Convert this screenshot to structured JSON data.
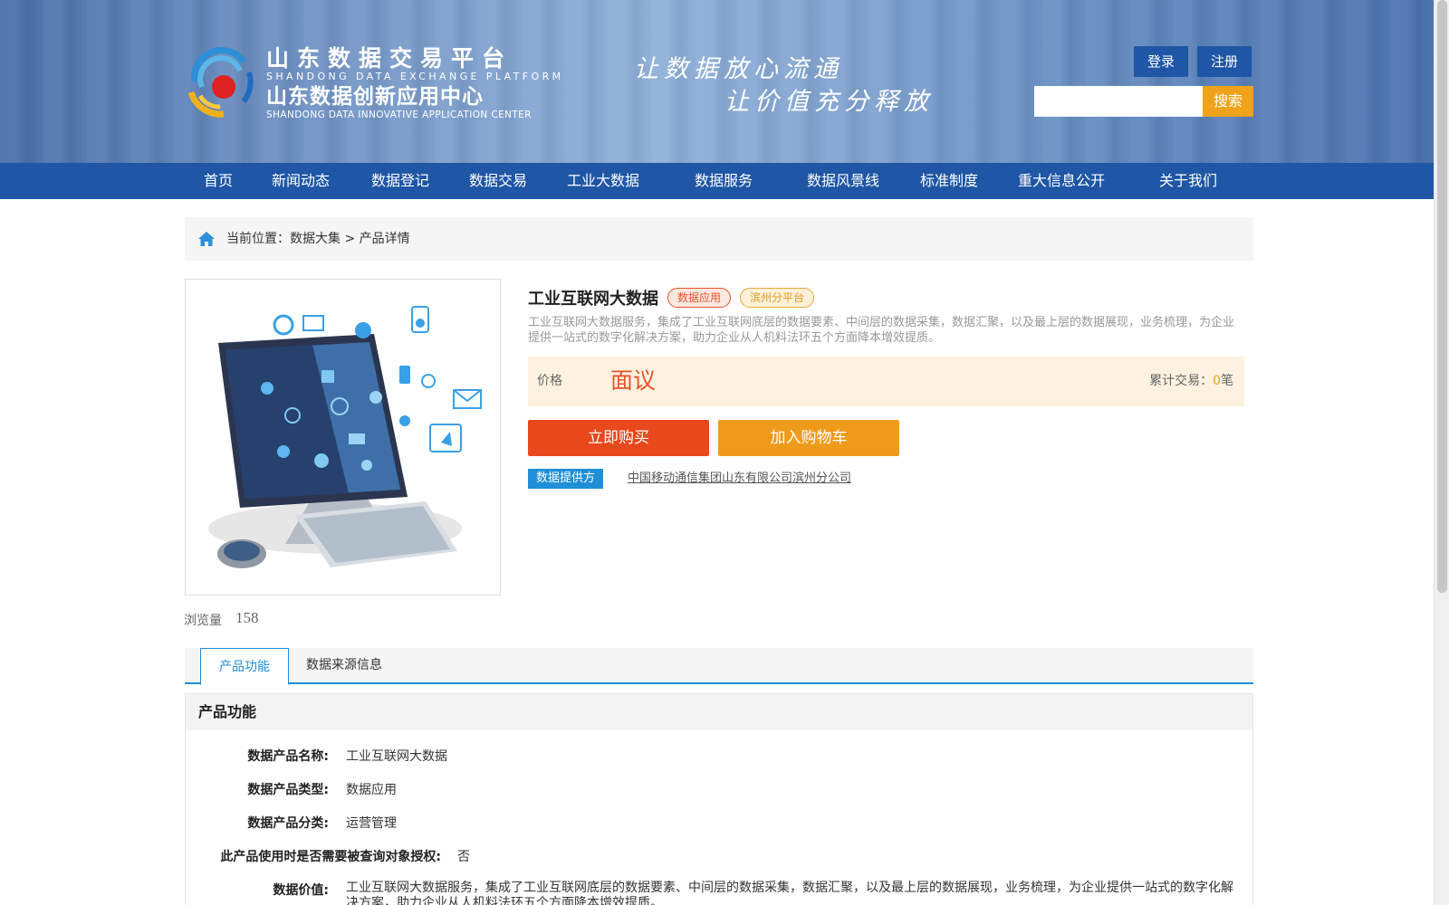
{
  "header": {
    "logo_cn_1": "山东数据交易平台",
    "logo_en_1": "SHANDONG DATA EXCHANGE PLATFORM",
    "logo_cn_2": "山东数据创新应用中心",
    "logo_en_2": "SHANDONG DATA INNOVATIVE APPLICATION CENTER",
    "slogan_1": "让数据放心流通",
    "slogan_2": "让价值充分释放",
    "login_label": "登录",
    "register_label": "注册",
    "search_value": "",
    "search_button": "搜索"
  },
  "nav": {
    "items": [
      "首页",
      "新闻动态",
      "数据登记",
      "数据交易",
      "工业大数据",
      "数据服务",
      "数据风景线",
      "标准制度",
      "重大信息公开",
      "关于我们"
    ]
  },
  "breadcrumb": {
    "text": "当前位置：数据大集 > 产品详情"
  },
  "product": {
    "title": "工业互联网大数据",
    "tag_type": "数据应用",
    "tag_platform": "滨州分平台",
    "description": "工业互联网大数据服务，集成了工业互联网底层的数据要素、中间层的数据采集，数据汇聚，以及最上层的数据展现，业务梳理，为企业提供一站式的数字化解决方案，助力企业从人机料法环五个方面降本增效提质。",
    "price_label": "价格",
    "price_value": "面议",
    "trades_label": "累计交易：",
    "trades_count": "0",
    "trades_unit": "笔",
    "buy_label": "立即购买",
    "cart_label": "加入购物车",
    "provider_label": "数据提供方",
    "provider_name": "中国移动通信集团山东有限公司滨州分公司",
    "views_label": "浏览量",
    "views_count": "158"
  },
  "tabs": {
    "active": "产品功能",
    "second": "数据来源信息"
  },
  "details": {
    "header": "产品功能",
    "rows": [
      {
        "label": "数据产品名称:",
        "value": "工业互联网大数据"
      },
      {
        "label": "数据产品类型:",
        "value": "数据应用"
      },
      {
        "label": "数据产品分类:",
        "value": "运营管理"
      },
      {
        "label": "此产品使用时是否需要被查询对象授权:",
        "value": "否"
      },
      {
        "label": "数据价值:",
        "value": "工业互联网大数据服务，集成了工业互联网底层的数据要素、中间层的数据采集，数据汇聚，以及最上层的数据展现，业务梳理，为企业提供一站式的数字化解决方案，助力企业从人机料法环五个方面降本增效提质。"
      }
    ]
  },
  "colors": {
    "brand_blue": "#1f56a5",
    "accent_orange": "#f0a21a",
    "buy_red": "#e9471c",
    "link_blue": "#1f8fd8"
  }
}
